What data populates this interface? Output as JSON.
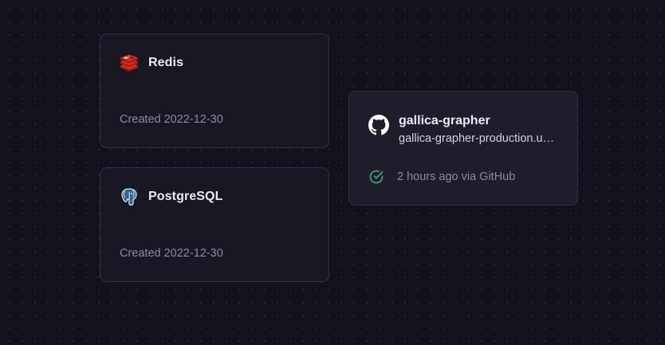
{
  "services": [
    {
      "name": "Redis",
      "icon": "redis-icon",
      "created": "Created 2022-12-30"
    },
    {
      "name": "PostgreSQL",
      "icon": "postgresql-icon",
      "created": "Created 2022-12-30"
    }
  ],
  "app": {
    "name": "gallica-grapher",
    "icon": "github-icon",
    "url": "gallica-grapher-production.up.railway.app",
    "deploy_status_icon": "check-circle-icon",
    "deploy_status": "2 hours ago via GitHub"
  },
  "colors": {
    "background": "#13111c",
    "card": "#191722",
    "card_border": "#34313f",
    "success": "#3fa37a",
    "redis_red": "#d82c20"
  }
}
